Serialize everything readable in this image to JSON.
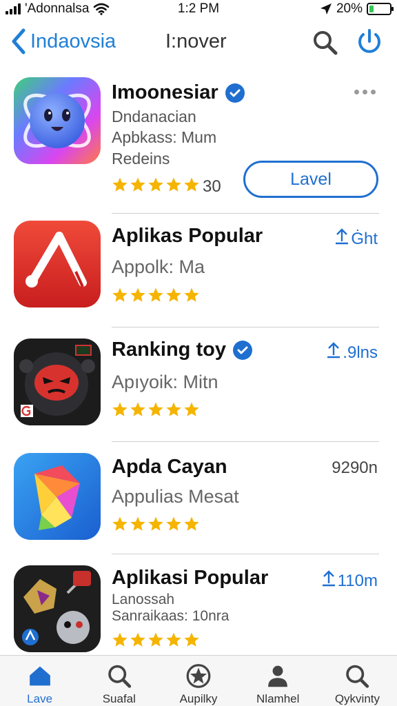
{
  "status_bar": {
    "carrier": "'Adonnalsa",
    "time": "1:2 PM",
    "battery_percent": "20%",
    "battery_level": 0.2,
    "battery_color": "#34c759"
  },
  "nav": {
    "back_label": "Indaovsia",
    "title": "I:nover",
    "search_icon": "search-icon",
    "power_icon": "power-icon",
    "accent": "#1f7fd6"
  },
  "apps": [
    {
      "name": "Imoonesiar",
      "verified": true,
      "lines": [
        "Dndanacian",
        "Apbkass: Mum",
        "Redeins"
      ],
      "rating": 5,
      "rating_count": "30",
      "action": "Lavel"
    },
    {
      "name": "Aplikas Popular",
      "verified": false,
      "lines": [
        "Appolk: Ma"
      ],
      "rating": 5,
      "size": "Ġht"
    },
    {
      "name": "Ranking toy",
      "verified": true,
      "lines": [
        "Apıyoik: Mitn"
      ],
      "rating": 5,
      "size": ".9lns"
    },
    {
      "name": "Apda Cayan",
      "verified": false,
      "lines": [
        "Appulias Mesat"
      ],
      "rating": 5,
      "size": "9290n"
    },
    {
      "name": "Aplikasi Popular",
      "verified": false,
      "lines": [
        "Lanossah",
        "Sanraikaas: 10nra"
      ],
      "rating": 5,
      "size": "110m"
    }
  ],
  "star_color": "#f5b400",
  "tabs": [
    {
      "label": "Lave",
      "icon": "home-icon",
      "active": true
    },
    {
      "label": "Suafal",
      "icon": "search-icon",
      "active": false
    },
    {
      "label": "Aupilky",
      "icon": "star-circle-icon",
      "active": false
    },
    {
      "label": "Nlamhel",
      "icon": "person-icon",
      "active": false
    },
    {
      "label": "Qykvinty",
      "icon": "search-icon",
      "active": false
    }
  ]
}
